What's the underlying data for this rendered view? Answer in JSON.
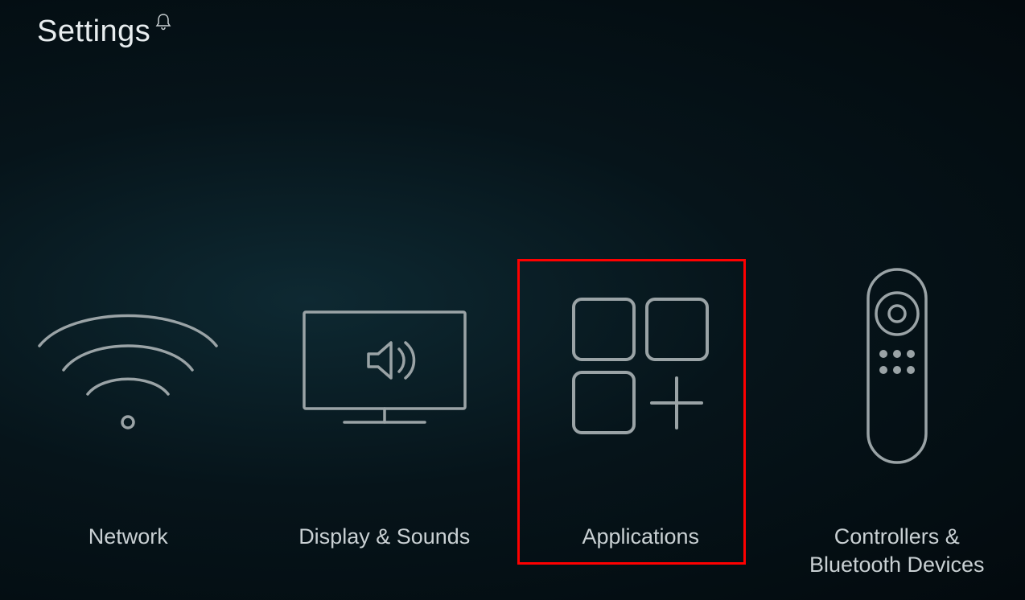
{
  "header": {
    "title": "Settings"
  },
  "tiles": [
    {
      "label": "Network",
      "icon": "wifi-icon"
    },
    {
      "label": "Display & Sounds",
      "icon": "display-sounds-icon"
    },
    {
      "label": "Applications",
      "icon": "apps-icon"
    },
    {
      "label": "Controllers &\nBluetooth Devices",
      "icon": "remote-icon"
    }
  ],
  "highlight_index": 2
}
